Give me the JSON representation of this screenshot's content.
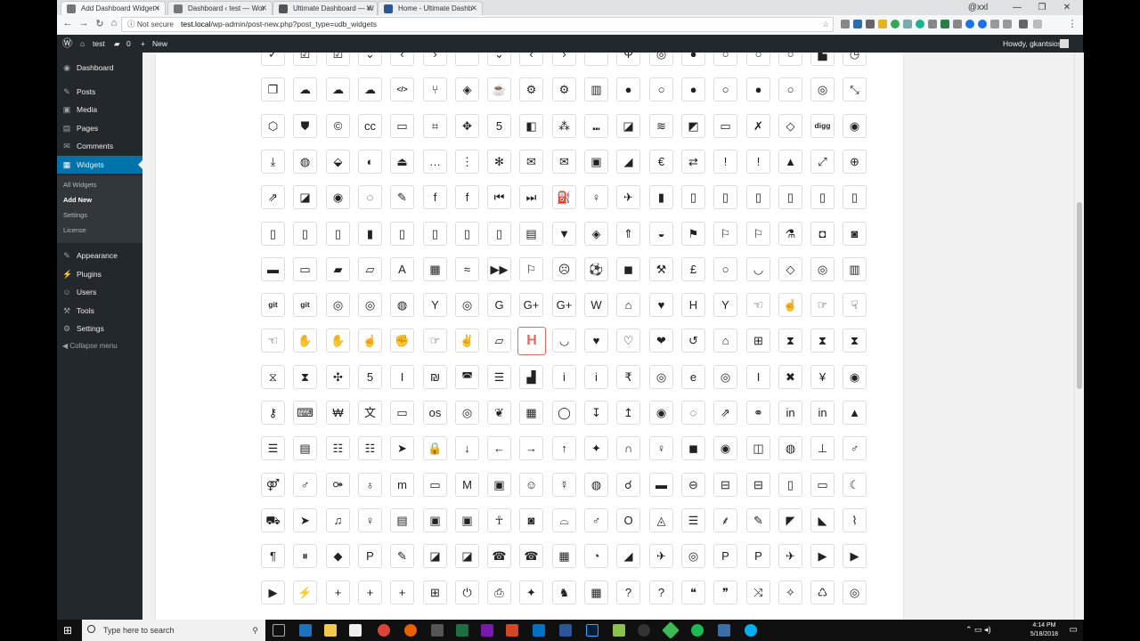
{
  "browser": {
    "tabs": [
      {
        "label": "Add Dashboard Widget ‹",
        "active": true
      },
      {
        "label": "Dashboard ‹ test — Wor",
        "active": false
      },
      {
        "label": "Ultimate Dashboard — W",
        "active": false
      },
      {
        "label": "Home - Ultimate Dashb",
        "active": false
      }
    ],
    "profile": "@xxl",
    "security_label": "Not secure",
    "url_host": "test.local",
    "url_path": "/wp-admin/post-new.php?post_type=udb_widgets"
  },
  "adminbar": {
    "site_name": "test",
    "comments_count": "0",
    "new_label": "New",
    "greeting": "Howdy, gkantsios"
  },
  "sidebar": {
    "items": [
      {
        "label": "Dashboard",
        "icon": "speedometer-icon",
        "glyph": "◉"
      },
      {
        "label": "Posts",
        "icon": "pin-icon",
        "glyph": "✎"
      },
      {
        "label": "Media",
        "icon": "media-icon",
        "glyph": "▣"
      },
      {
        "label": "Pages",
        "icon": "page-icon",
        "glyph": "▤"
      },
      {
        "label": "Comments",
        "icon": "comment-icon",
        "glyph": "✉"
      },
      {
        "label": "Widgets",
        "icon": "widgets-icon",
        "glyph": "▦",
        "active": true
      },
      {
        "label": "Appearance",
        "icon": "brush-icon",
        "glyph": "✎"
      },
      {
        "label": "Plugins",
        "icon": "plugin-icon",
        "glyph": "⚡"
      },
      {
        "label": "Users",
        "icon": "users-icon",
        "glyph": "☺"
      },
      {
        "label": "Tools",
        "icon": "wrench-icon",
        "glyph": "⚒"
      },
      {
        "label": "Settings",
        "icon": "settings-icon",
        "glyph": "⚙"
      }
    ],
    "submenu": [
      {
        "label": "All Widgets"
      },
      {
        "label": "Add New",
        "current": true
      },
      {
        "label": "Settings"
      },
      {
        "label": "License"
      }
    ],
    "collapse_label": "Collapse menu"
  },
  "icon_grid": {
    "rows": [
      [
        "✓",
        "☑",
        "☑",
        "⌄",
        "‹",
        "›",
        "⌃",
        "⌄",
        "‹",
        "›",
        "⌃",
        "Ψ",
        "◎",
        "●",
        "○",
        "○",
        "○",
        "▙",
        "◷"
      ],
      [
        "❐",
        "☁",
        "☁",
        "☁",
        "</>",
        "⑂",
        "◈",
        "☕",
        "⚙",
        "⚙",
        "▥",
        "●",
        "○",
        "●",
        "○",
        "●",
        "○",
        "◎",
        "⤡"
      ],
      [
        "⬡",
        "⛊",
        "©",
        "cc",
        "▭",
        "⌗",
        "✥",
        "5",
        "◧",
        "⁂",
        "⑉",
        "◪",
        "≋",
        "◩",
        "▭",
        "✗",
        "◇",
        "digg",
        "◉"
      ],
      [
        "⤓",
        "◍",
        "⬙",
        "◐",
        "⏏",
        "…",
        "⋮",
        "✻",
        "✉",
        "✉",
        "▣",
        "◢",
        "€",
        "⇄",
        "!",
        "!",
        "▲",
        "⤢",
        "⊕"
      ],
      [
        "⇗",
        "◪",
        "◉",
        "◌",
        "✎",
        "f",
        "f",
        "⏮",
        "⏭",
        "⛽",
        "♀",
        "✈",
        "▮",
        "▯",
        "▯",
        "▯",
        "▯",
        "▯",
        "▯"
      ],
      [
        "▯",
        "▯",
        "▯",
        "▮",
        "▯",
        "▯",
        "▯",
        "▯",
        "▤",
        "▼",
        "◈",
        "⇑",
        "◒",
        "⚑",
        "⚐",
        "⚐",
        "⚗",
        "◘",
        "◙"
      ],
      [
        "▬",
        "▭",
        "▰",
        "▱",
        "A",
        "▦",
        "≈",
        "▶▶",
        "⚐",
        "☹",
        "⚽",
        "◼",
        "⚒",
        "£",
        "○",
        "◡",
        "◇",
        "◎",
        "▥"
      ],
      [
        "git",
        "git",
        "◎",
        "◎",
        "◍",
        "Y",
        "◎",
        "G",
        "G+",
        "G+",
        "W",
        "⌂",
        "♥",
        "H",
        "Y",
        "☜",
        "☝",
        "☞",
        "☟"
      ],
      [
        "☜",
        "✋",
        "✋",
        "☝",
        "✊",
        "☞",
        "✌",
        "▱",
        "H",
        "◡",
        "♥",
        "♡",
        "❤",
        "↺",
        "⌂",
        "⊞",
        "⧗",
        "⧗",
        "⧗"
      ],
      [
        "⧖",
        "⧗",
        "✣",
        "5",
        "I",
        "₪",
        "◚",
        "☰",
        "▟",
        "i",
        "i",
        "₹",
        "◎",
        "e",
        "◎",
        "I",
        "✖",
        "¥",
        "◉"
      ],
      [
        "⚷",
        "⌨",
        "₩",
        "文",
        "▭",
        "os",
        "◎",
        "❦",
        "▦",
        "◯",
        "↧",
        "↥",
        "◉",
        "◌",
        "⇗",
        "⚭",
        "in",
        "in",
        "▲"
      ],
      [
        "☰",
        "▤",
        "☷",
        "☷",
        "➤",
        "🔒",
        "↓",
        "←",
        "→",
        "↑",
        "✦",
        "∩",
        "♀",
        "◼",
        "◉",
        "◫",
        "◍",
        "⊥",
        "♂"
      ],
      [
        "⚤",
        "♂",
        "⚩",
        "♁",
        "m",
        "▭",
        "M",
        "▣",
        "☺",
        "☿",
        "◍",
        "☌",
        "▬",
        "⊖",
        "⊟",
        "⊟",
        "▯",
        "▭",
        "☾"
      ],
      [
        "⛟",
        "➤",
        "♫",
        "♀",
        "▤",
        "▣",
        "▣",
        "☥",
        "◙",
        "⌓",
        "♂",
        "O",
        "◬",
        "☰",
        "⸙",
        "✎",
        "◤",
        "◣",
        "⌇"
      ],
      [
        "¶",
        "⏸",
        "◆",
        "P",
        "✎",
        "◪",
        "◪",
        "☎",
        "☎",
        "▦",
        "◔",
        "◢",
        "✈",
        "◎",
        "P",
        "P",
        "✈",
        "▶",
        "▶"
      ],
      [
        "▶",
        "⚡",
        "+",
        "+",
        "+",
        "⊞",
        "⏻",
        "⎙",
        "✦",
        "♞",
        "▦",
        "?",
        "?",
        "❝",
        "❞",
        "⤨",
        "✧",
        "♺",
        "◎"
      ]
    ],
    "selected_row": 8,
    "selected_col": 8
  },
  "taskbar": {
    "search_placeholder": "Type here to search",
    "time": "4:14 PM",
    "date": "5/18/2018"
  }
}
